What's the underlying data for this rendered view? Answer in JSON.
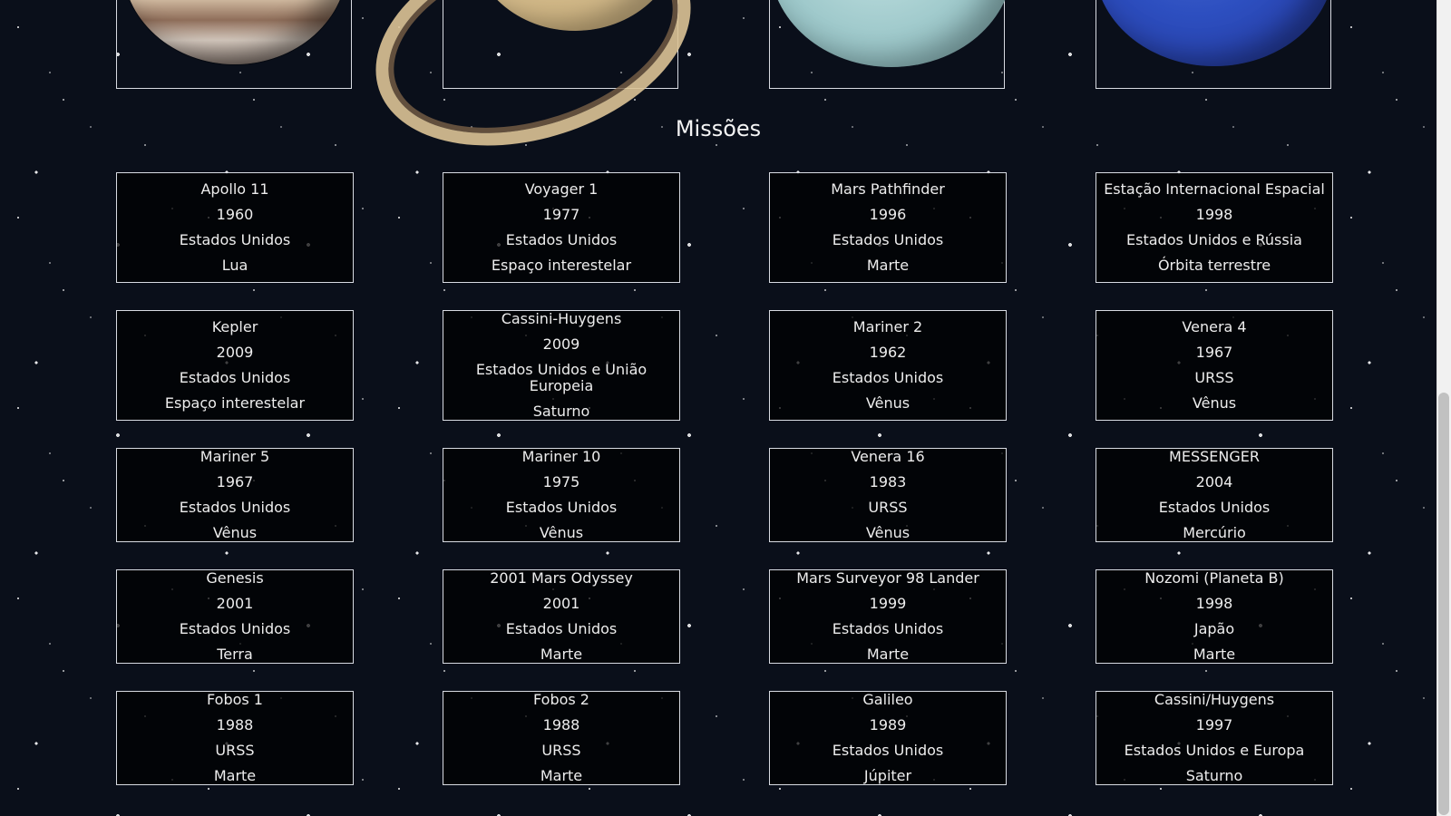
{
  "section": {
    "title": "Missões"
  },
  "planets": [
    {
      "name": "Júpiter",
      "icon": "jupiter-image"
    },
    {
      "name": "Saturno",
      "icon": "saturn-image"
    },
    {
      "name": "Urano",
      "icon": "uranus-image"
    },
    {
      "name": "Netuno",
      "icon": "neptune-image"
    }
  ],
  "missions": [
    {
      "name": "Apollo 11",
      "year": "1960",
      "country": "Estados Unidos",
      "destination": "Lua"
    },
    {
      "name": "Voyager 1",
      "year": "1977",
      "country": "Estados Unidos",
      "destination": "Espaço interestelar"
    },
    {
      "name": "Mars Pathfinder",
      "year": "1996",
      "country": "Estados Unidos",
      "destination": "Marte"
    },
    {
      "name": "Estação Internacional Espacial",
      "year": "1998",
      "country": "Estados Unidos e Rússia",
      "destination": "Órbita terrestre"
    },
    {
      "name": "Kepler",
      "year": "2009",
      "country": "Estados Unidos",
      "destination": "Espaço interestelar"
    },
    {
      "name": "Cassini-Huygens",
      "year": "2009",
      "country": "Estados Unidos e União Europeia",
      "destination": "Saturno"
    },
    {
      "name": "Mariner 2",
      "year": "1962",
      "country": "Estados Unidos",
      "destination": "Vênus"
    },
    {
      "name": "Venera 4",
      "year": "1967",
      "country": "URSS",
      "destination": "Vênus"
    },
    {
      "name": "Mariner 5",
      "year": "1967",
      "country": "Estados Unidos",
      "destination": "Vênus"
    },
    {
      "name": "Mariner 10",
      "year": "1975",
      "country": "Estados Unidos",
      "destination": "Vênus"
    },
    {
      "name": "Venera 16",
      "year": "1983",
      "country": "URSS",
      "destination": "Vênus"
    },
    {
      "name": "MESSENGER",
      "year": "2004",
      "country": "Estados Unidos",
      "destination": "Mercúrio"
    },
    {
      "name": "Genesis",
      "year": "2001",
      "country": "Estados Unidos",
      "destination": "Terra"
    },
    {
      "name": "2001 Mars Odyssey",
      "year": "2001",
      "country": "Estados Unidos",
      "destination": "Marte"
    },
    {
      "name": "Mars Surveyor 98 Lander",
      "year": "1999",
      "country": "Estados Unidos",
      "destination": "Marte"
    },
    {
      "name": "Nozomi (Planeta B)",
      "year": "1998",
      "country": "Japão",
      "destination": "Marte"
    },
    {
      "name": "Fobos 1",
      "year": "1988",
      "country": "URSS",
      "destination": "Marte"
    },
    {
      "name": "Fobos 2",
      "year": "1988",
      "country": "URSS",
      "destination": "Marte"
    },
    {
      "name": "Galileo",
      "year": "1989",
      "country": "Estados Unidos",
      "destination": "Júpiter"
    },
    {
      "name": "Cassini/Huygens",
      "year": "1997",
      "country": "Estados Unidos e Europa",
      "destination": "Saturno"
    }
  ],
  "colors": {
    "background": "#0a0f1a",
    "card_border": "#d8dbe2",
    "text": "#ededed"
  }
}
